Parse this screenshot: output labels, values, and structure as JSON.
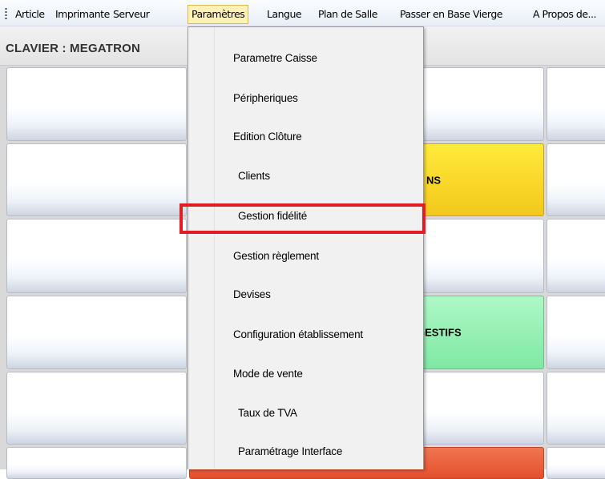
{
  "menubar": {
    "items": [
      {
        "label": "Article"
      },
      {
        "label": "Imprimante"
      },
      {
        "label": "Serveur"
      },
      {
        "label": "Paramètres"
      },
      {
        "label": "Langue"
      },
      {
        "label": "Plan de Salle"
      },
      {
        "label": "Passer en Base Vierge"
      },
      {
        "label": "A Propos de..."
      }
    ],
    "active_label": "Paramètres"
  },
  "header": {
    "title": "CLAVIER : MEGATRON"
  },
  "keys": [
    {
      "label": ""
    },
    {
      "label": ""
    },
    {
      "label": ""
    },
    {
      "label": ""
    },
    {
      "label": "NS",
      "color": "#f7d52a"
    },
    {
      "label": ""
    },
    {
      "label": ""
    },
    {
      "label": ""
    },
    {
      "label": ""
    },
    {
      "label": ""
    },
    {
      "label": "GESTIFS",
      "color": "#8ef0b0"
    },
    {
      "label": ""
    },
    {
      "label": ""
    },
    {
      "label": ""
    },
    {
      "label": ""
    },
    {
      "label": ""
    },
    {
      "label": "",
      "color": "#e8562f"
    },
    {
      "label": ""
    }
  ],
  "dropdown": {
    "items": [
      {
        "label": "Parametre Caisse"
      },
      {
        "label": "Péripheriques"
      },
      {
        "label": "Edition Clôture"
      },
      {
        "label": "Clients"
      },
      {
        "label": "Gestion fidélité",
        "highlighted": true
      },
      {
        "label": "Gestion règlement"
      },
      {
        "label": "Devises"
      },
      {
        "label": "Configuration établissement"
      },
      {
        "label": "Mode de vente"
      },
      {
        "label": "Taux de TVA"
      },
      {
        "label": "Paramétrage Interface"
      }
    ]
  },
  "annotation": {
    "color": "#e31b23"
  }
}
